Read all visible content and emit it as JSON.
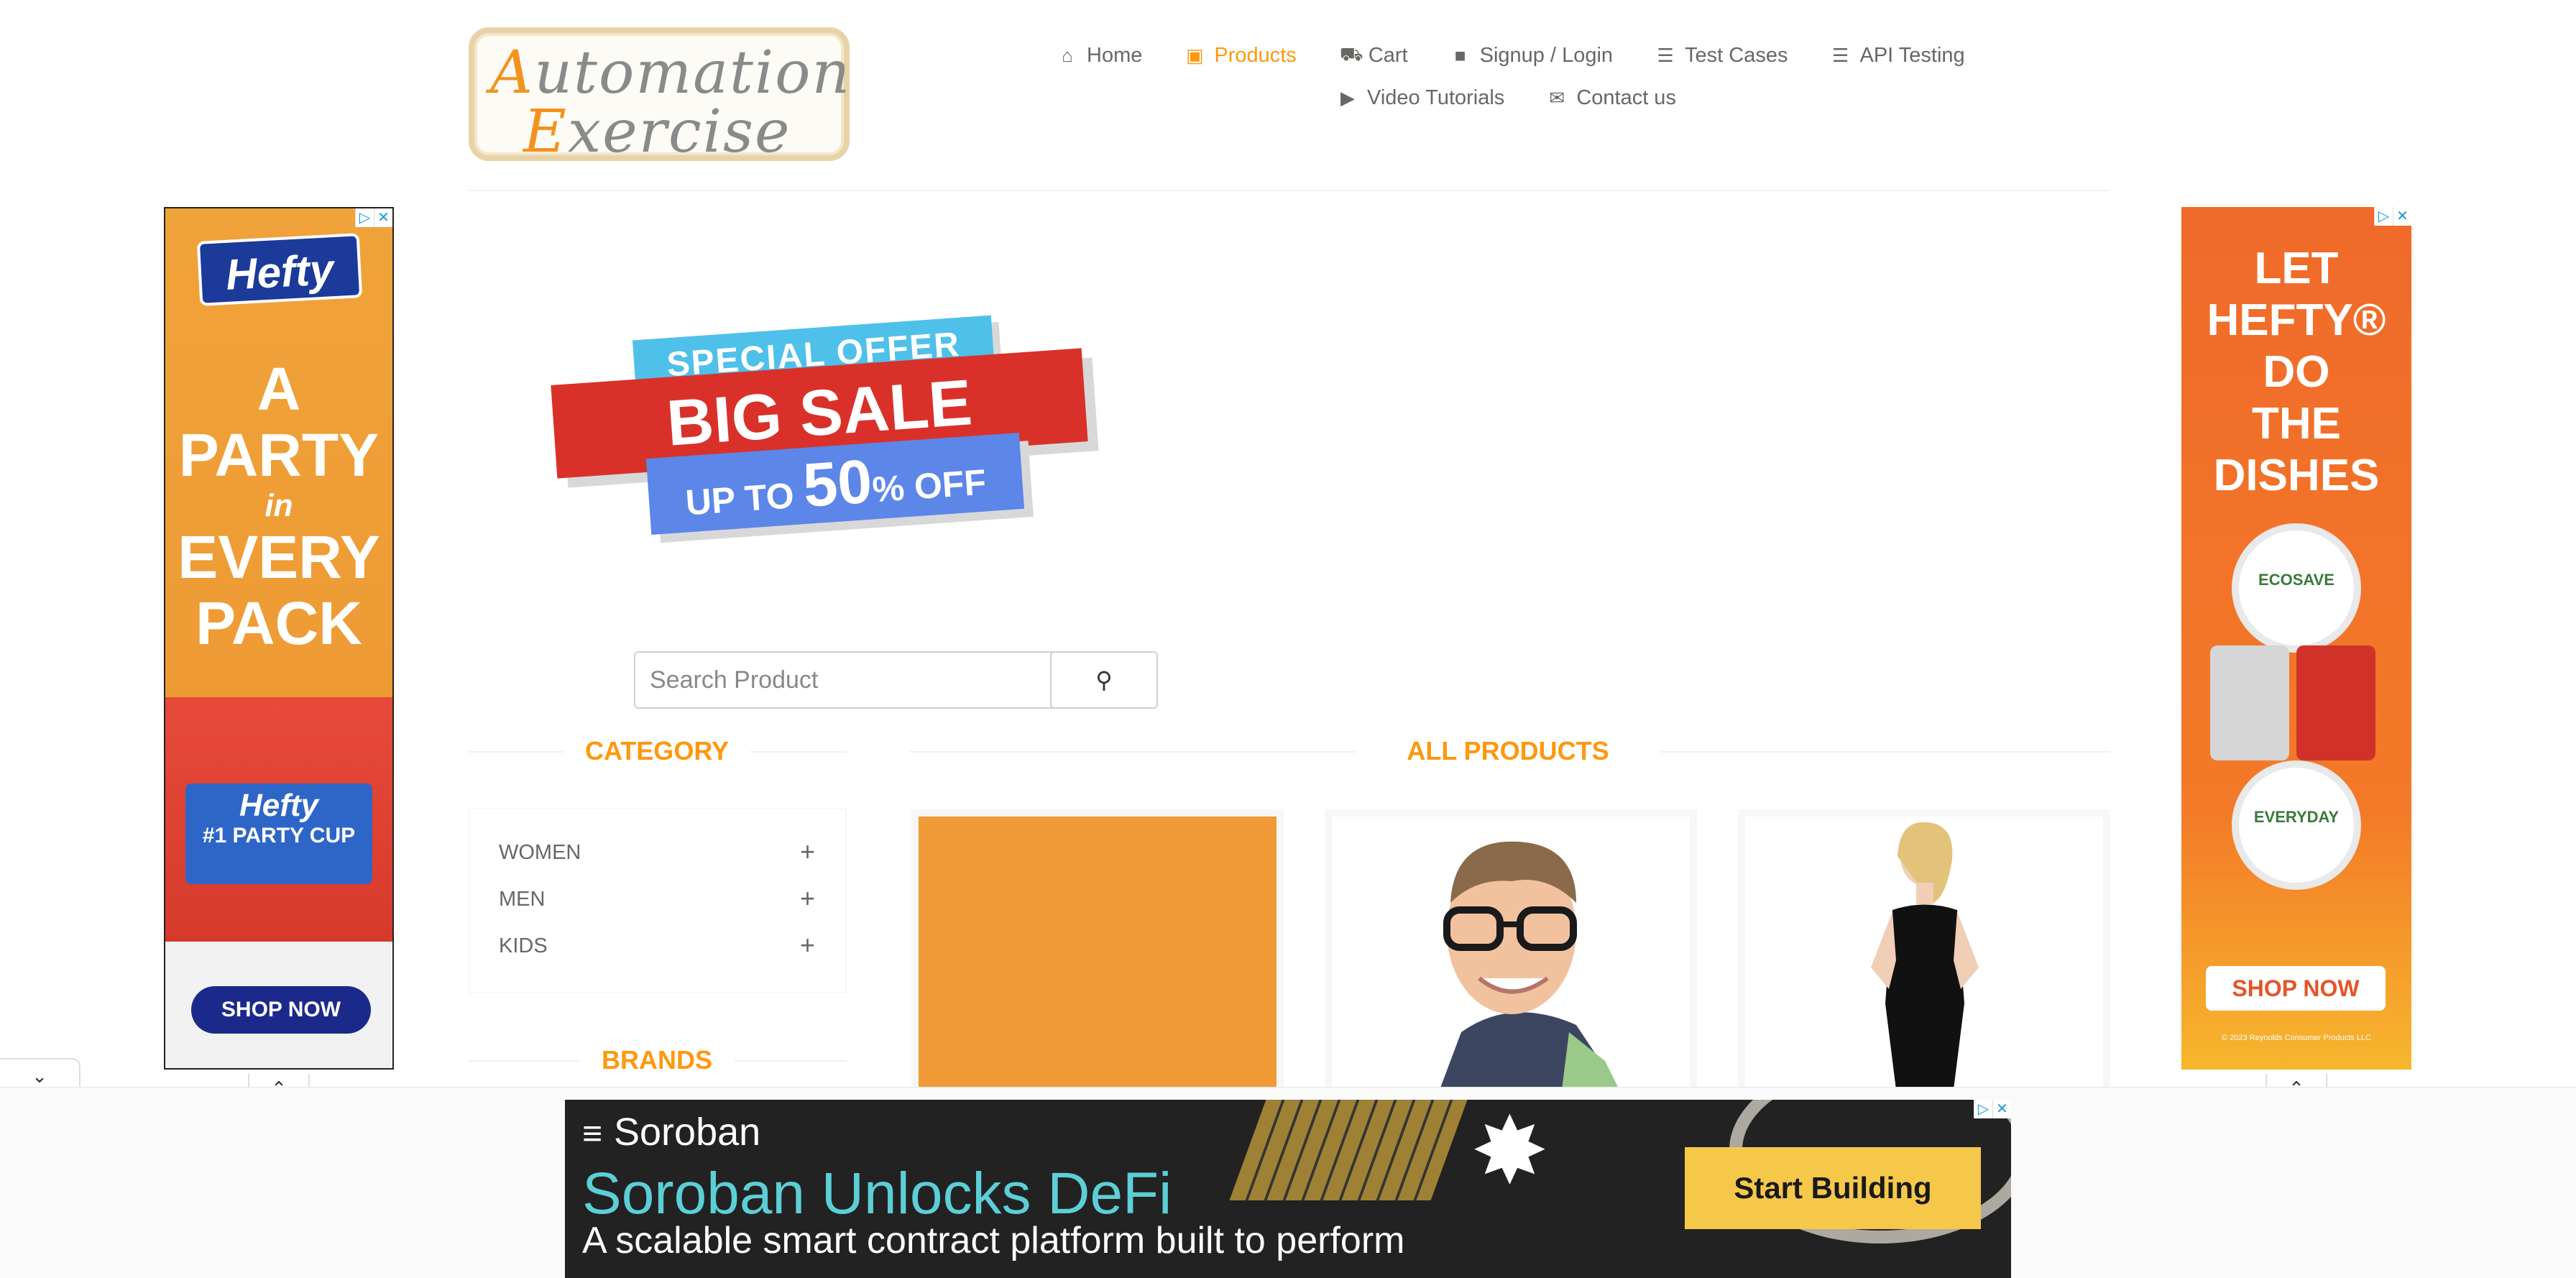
{
  "logo": {
    "line1_cap": "A",
    "line1_rest": "utomation",
    "line2_cap": "E",
    "line2_rest": "xercise"
  },
  "nav": {
    "row1": [
      {
        "icon": "home-icon",
        "glyph": "⌂",
        "label": "Home",
        "active": false
      },
      {
        "icon": "products-icon",
        "glyph": "▣",
        "label": "Products",
        "active": true
      },
      {
        "icon": "cart-icon",
        "glyph": "⛟",
        "label": "Cart",
        "active": false
      },
      {
        "icon": "lock-icon",
        "glyph": "■",
        "label": "Signup / Login",
        "active": false
      },
      {
        "icon": "list-icon",
        "glyph": "☰",
        "label": "Test Cases",
        "active": false
      },
      {
        "icon": "list-icon",
        "glyph": "☰",
        "label": "API Testing",
        "active": false
      }
    ],
    "row2": [
      {
        "icon": "youtube-icon",
        "glyph": "▶",
        "label": "Video Tutorials",
        "active": false
      },
      {
        "icon": "envelope-icon",
        "glyph": "✉",
        "label": "Contact us",
        "active": false
      }
    ]
  },
  "left_ad": {
    "brand": "Hefty",
    "line1": "A",
    "line2": "PARTY",
    "line3": "in",
    "line4": "EVERY",
    "line5": "PACK",
    "product_brand": "Hefty",
    "product_name": "#1 PARTY CUP",
    "cta": "SHOP NOW"
  },
  "right_ad": {
    "line1": "LET",
    "line2": "HEFTY®",
    "line3": "DO",
    "line4": "THE",
    "line5": "DISHES",
    "plate1": "ECOSAVE",
    "plate2": "EVERYDAY",
    "cta": "SHOP NOW",
    "copyright": "© 2023 Reynolds Consumer Products LLC"
  },
  "banner": {
    "special": "SPECIAL OFFER",
    "big": "BIG SALE",
    "up_to": "UP TO",
    "pct": "50",
    "pct_suffix": "% OFF"
  },
  "search": {
    "placeholder": "Search Product",
    "button_glyph": "⚲"
  },
  "category": {
    "title": "CATEGORY",
    "items": [
      {
        "label": "WOMEN",
        "plus": "+"
      },
      {
        "label": "MEN",
        "plus": "+"
      },
      {
        "label": "KIDS",
        "plus": "+"
      }
    ]
  },
  "brands": {
    "title": "BRANDS"
  },
  "products": {
    "title": "ALL PRODUCTS"
  },
  "bottom_ad": {
    "brand": "Soroban",
    "headline": "Soroban Unlocks DeFi",
    "sub": "A scalable smart contract platform built to perform",
    "cta": "Start Building"
  },
  "toggles": {
    "up": "⌃",
    "down": "⌄"
  },
  "colors": {
    "accent": "#fe980f",
    "text": "#696763",
    "ad_orange": "#f0a33a",
    "ad_blue": "#1b2a8a",
    "soroban_teal": "#5ccfd6",
    "cta_yellow": "#f6c84a"
  }
}
